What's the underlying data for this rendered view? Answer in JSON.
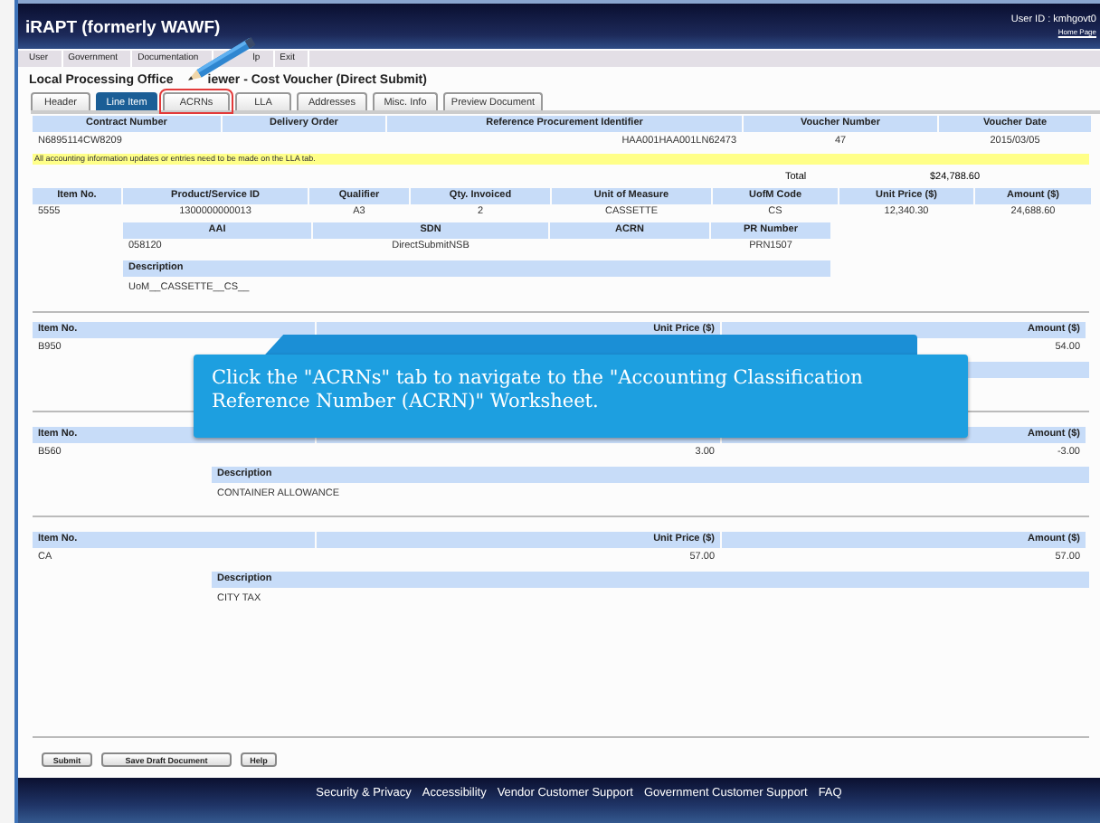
{
  "app": {
    "title": "iRAPT (formerly WAWF)",
    "user_label": "User ID :",
    "user_id": "kmhgovt0",
    "home_link": "Home Page"
  },
  "menu": [
    "User",
    "Government",
    "Documentation",
    "lp",
    "Exit"
  ],
  "page_title_parts": [
    "Local Processing Office",
    "iewer - Cost Voucher (Direct Submit)"
  ],
  "tabs": [
    {
      "label": "Header",
      "selected": false,
      "highlighted": false
    },
    {
      "label": "Line Item",
      "selected": true,
      "highlighted": false
    },
    {
      "label": "ACRNs",
      "selected": false,
      "highlighted": true
    },
    {
      "label": "LLA",
      "selected": false,
      "highlighted": false
    },
    {
      "label": "Addresses",
      "selected": false,
      "highlighted": false
    },
    {
      "label": "Misc. Info",
      "selected": false,
      "highlighted": false
    },
    {
      "label": "Preview Document",
      "selected": false,
      "highlighted": false
    }
  ],
  "summary": {
    "columns": [
      {
        "label": "Contract Number",
        "value": "N6895114CW8209"
      },
      {
        "label": "Delivery Order"
      },
      {
        "label": "Reference Procurement Identifier",
        "value": "HAA001HAA001LN62473"
      },
      {
        "label": "Voucher Number",
        "value": "47"
      },
      {
        "label": "Voucher Date",
        "value": "2015/03/05"
      }
    ]
  },
  "notice": "All accounting information updates or entries need to be made on the LLA tab.",
  "total": {
    "label": "Total",
    "value": "$24,788.60"
  },
  "first_item": {
    "columns": [
      "Item No.",
      "Product/Service ID",
      "Qualifier",
      "Qty. Invoiced",
      "Unit of Measure",
      "UofM Code",
      "Unit Price ($)",
      "Amount ($)"
    ],
    "values": [
      "5555",
      "1300000000013",
      "A3",
      "2",
      "CASSETTE",
      "CS",
      "12,340.30",
      "24,688.60"
    ],
    "sub_columns": [
      {
        "label": "AAI",
        "value": "058120"
      },
      {
        "label": "SDN",
        "value": "DirectSubmitNSB"
      },
      {
        "label": "ACRN"
      },
      {
        "label": "PR Number",
        "value": "PRN1507"
      }
    ],
    "description_label": "Description",
    "description": "UoM__CASSETTE__CS__"
  },
  "line_items": [
    {
      "cells": [
        {
          "header": "Item No.",
          "value": "B950"
        },
        {
          "header": "Unit Price ($)"
        },
        {
          "header": "Amount ($)",
          "value": "54.00"
        }
      ]
    },
    {
      "cells": [
        {
          "header": "Item No.",
          "value": "B560"
        },
        {
          "value": "3.00"
        },
        {
          "header": "Amount ($)",
          "value": "-3.00"
        }
      ],
      "description_label": "Description",
      "description": "CONTAINER ALLOWANCE"
    },
    {
      "cells": [
        {
          "header": "Item No.",
          "value": "CA"
        },
        {
          "header": "Unit Price ($)",
          "value": "57.00"
        },
        {
          "header": "Amount ($)",
          "value": "57.00"
        }
      ],
      "description_label": "Description",
      "description": "CITY TAX"
    }
  ],
  "buttons": [
    "Submit",
    "Save Draft Document",
    "Help"
  ],
  "footer_links": [
    "Security & Privacy",
    "Accessibility",
    "Vendor Customer Support",
    "Government Customer Support",
    "FAQ"
  ],
  "callout": {
    "text": "Click the \"ACRNs\" tab to navigate to the \"Accounting Classification Reference Number (ACRN)\" Worksheet."
  }
}
